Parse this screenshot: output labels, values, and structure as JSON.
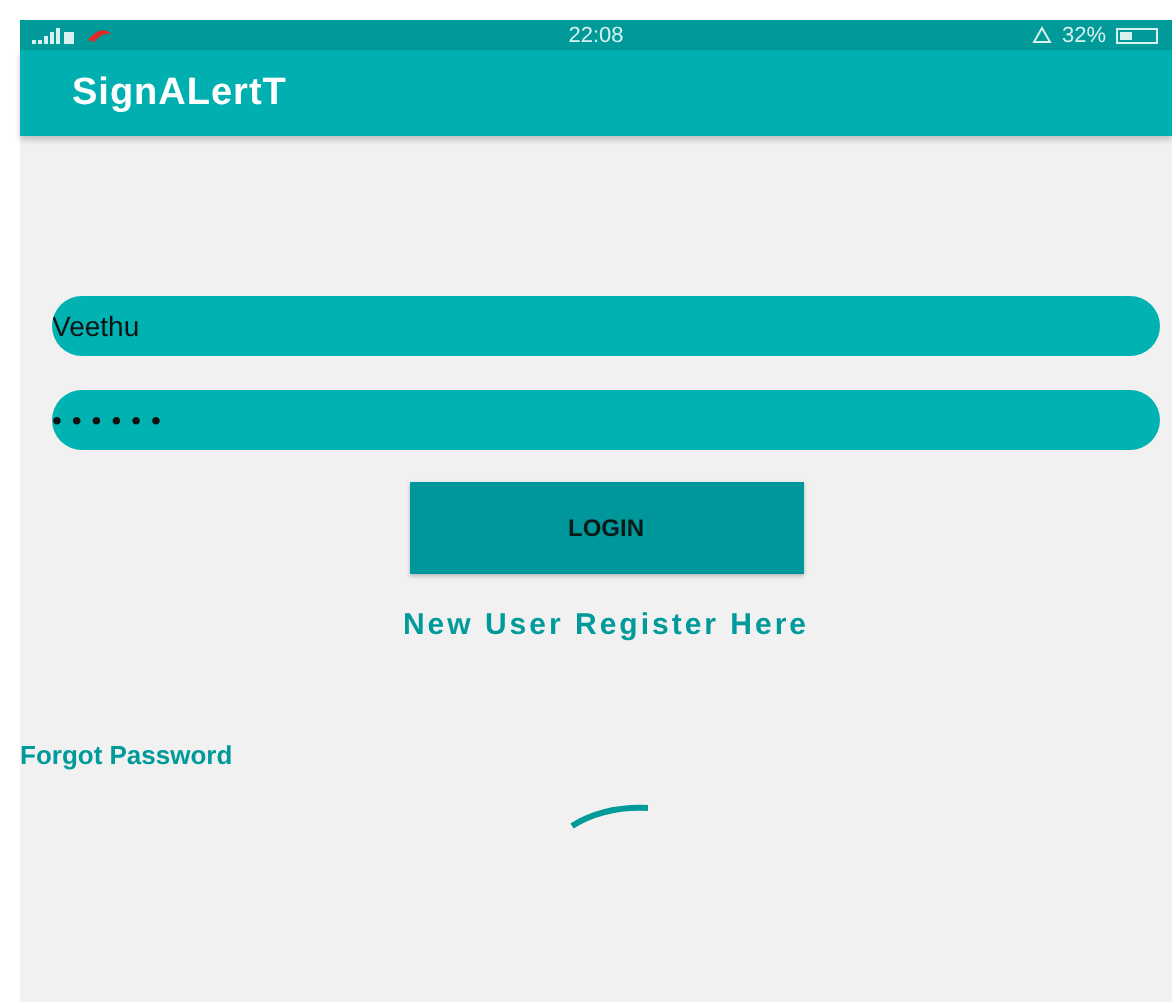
{
  "status_bar": {
    "time": "22:08",
    "battery": "32%"
  },
  "app_bar": {
    "title": "SignALertT"
  },
  "form": {
    "username": {
      "value": "Veethu"
    },
    "password": {
      "value": "••••••"
    },
    "login_button": "LOGIN",
    "register_link": "New User Register Here",
    "forgot_link": "Forgot Password"
  },
  "loading": true
}
